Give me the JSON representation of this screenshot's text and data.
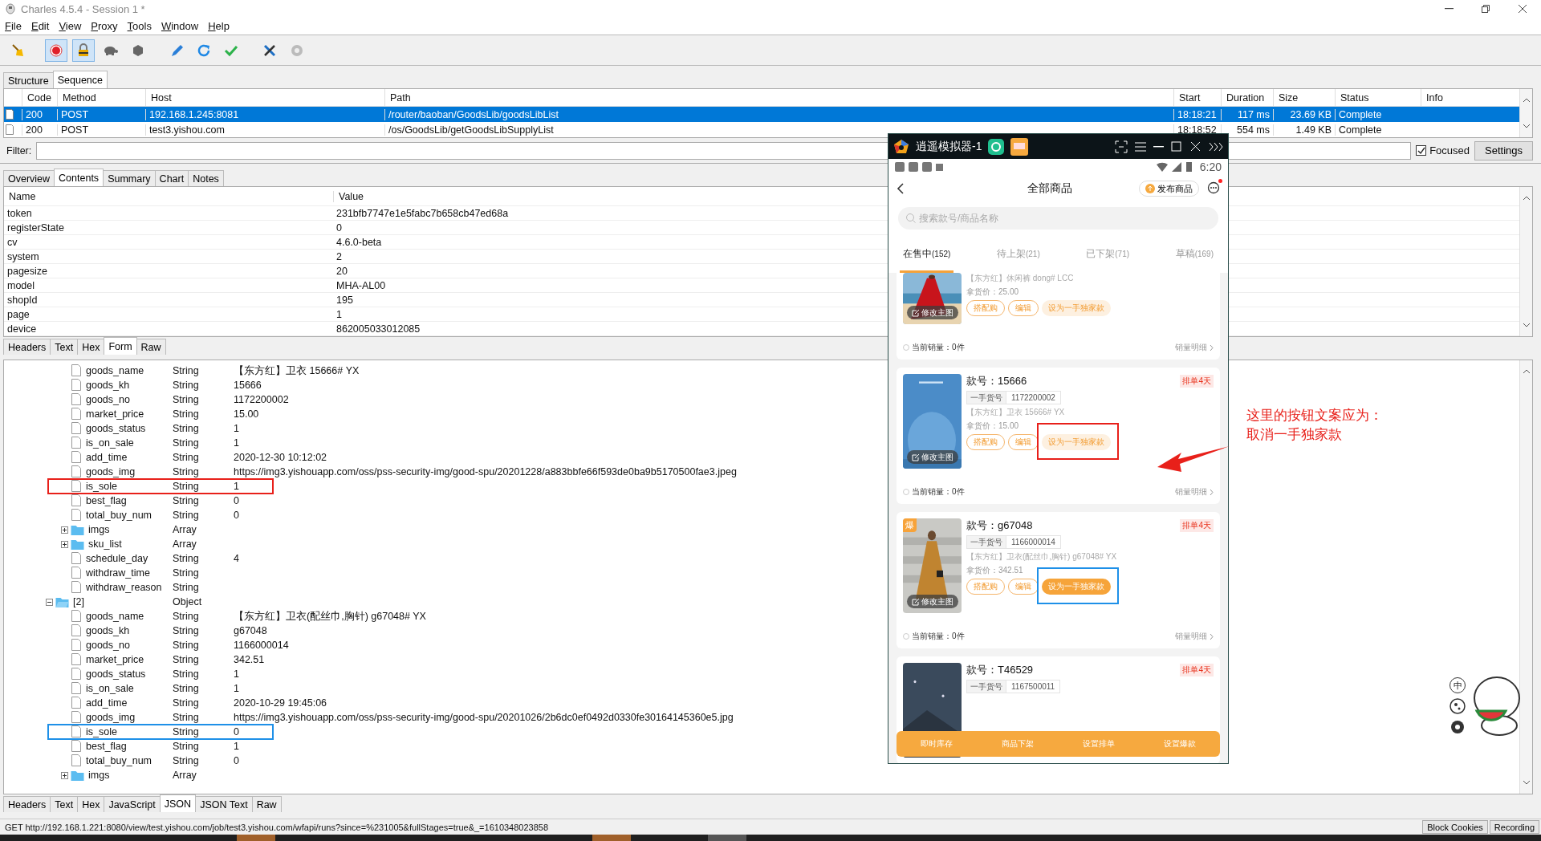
{
  "window": {
    "title": "Charles 4.5.4 - Session 1 *"
  },
  "menu": [
    "File",
    "Edit",
    "View",
    "Proxy",
    "Tools",
    "Window",
    "Help"
  ],
  "toolbar": [
    {
      "kind": "broom",
      "pressed": false
    },
    {
      "kind": "record",
      "pressed": true
    },
    {
      "kind": "throttle",
      "pressed": true
    },
    {
      "kind": "turtle",
      "pressed": false
    },
    {
      "kind": "stop",
      "pressed": false
    },
    {
      "kind": "pen",
      "pressed": false
    },
    {
      "kind": "refresh",
      "pressed": false
    },
    {
      "kind": "check",
      "pressed": false
    },
    {
      "kind": "tools",
      "pressed": false
    },
    {
      "kind": "gear",
      "pressed": false
    }
  ],
  "view_tabs": [
    {
      "label": "Structure",
      "selected": false
    },
    {
      "label": "Sequence",
      "selected": true
    }
  ],
  "requests": {
    "columns": [
      "Code",
      "Method",
      "Host",
      "Path",
      "Start",
      "Duration",
      "Size",
      "Status",
      "Info"
    ],
    "rows": [
      {
        "selected": true,
        "cells": [
          "200",
          "POST",
          "192.168.1.245:8081",
          "/router/baoban/GoodsLib/goodsLibList",
          "18:18:21",
          "117 ms",
          "23.69 KB",
          "Complete"
        ]
      },
      {
        "selected": false,
        "cells": [
          "200",
          "POST",
          "test3.yishou.com",
          "/os/GoodsLib/getGoodsLibSupplyList",
          "18:18:52",
          "554 ms",
          "1.49 KB",
          "Complete"
        ]
      }
    ]
  },
  "filter": {
    "label": "Filter:",
    "focused": {
      "label": "Focused",
      "checked": true
    },
    "settings": "Settings"
  },
  "detail_tabs": [
    {
      "label": "Overview",
      "selected": false
    },
    {
      "label": "Contents",
      "selected": true
    },
    {
      "label": "Summary",
      "selected": false
    },
    {
      "label": "Chart",
      "selected": false
    },
    {
      "label": "Notes",
      "selected": false
    }
  ],
  "params": {
    "columns": [
      "Name",
      "Value"
    ],
    "rows": [
      [
        "token",
        "231bfb7747e1e5fabc7b658cb47ed68a"
      ],
      [
        "registerState",
        "0"
      ],
      [
        "cv",
        "4.6.0-beta"
      ],
      [
        "system",
        "2"
      ],
      [
        "pagesize",
        "20"
      ],
      [
        "model",
        "MHA-AL00"
      ],
      [
        "shopId",
        "195"
      ],
      [
        "page",
        "1"
      ],
      [
        "device",
        "862005033012085"
      ]
    ]
  },
  "body_tabs": [
    {
      "label": "Headers",
      "selected": false
    },
    {
      "label": "Text",
      "selected": false
    },
    {
      "label": "Hex",
      "selected": false
    },
    {
      "label": "Form",
      "selected": true
    },
    {
      "label": "Raw",
      "selected": false
    }
  ],
  "tree": {
    "continued_children": [
      {
        "kind": "string",
        "name": "goods_name",
        "type": "String",
        "value": "【东方红】卫衣  15666#  YX"
      },
      {
        "kind": "string",
        "name": "goods_kh",
        "type": "String",
        "value": "15666"
      },
      {
        "kind": "string",
        "name": "goods_no",
        "type": "String",
        "value": "1172200002"
      },
      {
        "kind": "string",
        "name": "market_price",
        "type": "String",
        "value": "15.00"
      },
      {
        "kind": "string",
        "name": "goods_status",
        "type": "String",
        "value": "1"
      },
      {
        "kind": "string",
        "name": "is_on_sale",
        "type": "String",
        "value": "1"
      },
      {
        "kind": "string",
        "name": "add_time",
        "type": "String",
        "value": "2020-12-30 10:12:02"
      },
      {
        "kind": "string",
        "name": "goods_img",
        "type": "String",
        "value": "https://img3.yishouapp.com/oss/pss-security-img/good-spu/20201228/a883bbfe66f593de0ba9b5170500fae3.jpeg"
      },
      {
        "kind": "string",
        "name": "is_sole",
        "type": "String",
        "value": "1",
        "annotation": {
          "color": "#e8201a"
        }
      },
      {
        "kind": "string",
        "name": "best_flag",
        "type": "String",
        "value": "0"
      },
      {
        "kind": "string",
        "name": "total_buy_num",
        "type": "String",
        "value": "0"
      },
      {
        "kind": "array",
        "name": "imgs",
        "type": "Array",
        "expanded": false
      },
      {
        "kind": "array",
        "name": "sku_list",
        "type": "Array",
        "expanded": false
      },
      {
        "kind": "string",
        "name": "schedule_day",
        "type": "String",
        "value": "4"
      },
      {
        "kind": "string",
        "name": "withdraw_time",
        "type": "String"
      },
      {
        "kind": "string",
        "name": "withdraw_reason",
        "type": "String"
      }
    ],
    "nodes": [
      {
        "kind": "object",
        "name": "[2]",
        "type": "Object",
        "expanded": true,
        "children": [
          {
            "kind": "string",
            "name": "goods_name",
            "type": "String",
            "value": "【东方红】卫衣(配丝巾,胸针)  g67048#  YX"
          },
          {
            "kind": "string",
            "name": "goods_kh",
            "type": "String",
            "value": "g67048"
          },
          {
            "kind": "string",
            "name": "goods_no",
            "type": "String",
            "value": "1166000014"
          },
          {
            "kind": "string",
            "name": "market_price",
            "type": "String",
            "value": "342.51"
          },
          {
            "kind": "string",
            "name": "goods_status",
            "type": "String",
            "value": "1"
          },
          {
            "kind": "string",
            "name": "is_on_sale",
            "type": "String",
            "value": "1"
          },
          {
            "kind": "string",
            "name": "add_time",
            "type": "String",
            "value": "2020-10-29 19:45:06"
          },
          {
            "kind": "string",
            "name": "goods_img",
            "type": "String",
            "value": "https://img3.yishouapp.com/oss/pss-security-img/good-spu/20201026/2b6dc0ef0492d0330fe30164145360e5.jpg"
          },
          {
            "kind": "string",
            "name": "is_sole",
            "type": "String",
            "value": "0",
            "annotation": {
              "color": "#1e90e8"
            }
          },
          {
            "kind": "string",
            "name": "best_flag",
            "type": "String",
            "value": "1"
          },
          {
            "kind": "string",
            "name": "total_buy_num",
            "type": "String",
            "value": "0"
          },
          {
            "kind": "array",
            "name": "imgs",
            "type": "Array",
            "expanded": false
          }
        ]
      }
    ]
  },
  "response_tabs": [
    {
      "label": "Headers",
      "selected": false
    },
    {
      "label": "Text",
      "selected": false
    },
    {
      "label": "Hex",
      "selected": false
    },
    {
      "label": "JavaScript",
      "selected": false
    },
    {
      "label": "JSON",
      "selected": true
    },
    {
      "label": "JSON Text",
      "selected": false
    },
    {
      "label": "Raw",
      "selected": false
    }
  ],
  "status_bar": {
    "text": "GET http://192.168.1.221:8080/view/test.yishou.com/job/test3.yishou.com/wfapi/runs?since=%231005&fullStages=true&_=1610348023858",
    "buttons": [
      "Block Cookies",
      "Recording"
    ]
  },
  "emulator": {
    "title": "逍遥模拟器-1",
    "time": "6:20",
    "page_title": "全部商品",
    "publish": "发布商品",
    "search_placeholder": "搜索款号/商品名称",
    "tabs": [
      {
        "label": "在售中",
        "count": "(152)",
        "selected": true
      },
      {
        "label": "待上架",
        "count": "(21)",
        "selected": false
      },
      {
        "label": "已下架",
        "count": "(71)",
        "selected": false
      },
      {
        "label": "草稿",
        "count": "(169)",
        "selected": false
      }
    ],
    "products": [
      {
        "name": "【东方红】休闲裤 dong# LCC",
        "price": "拿货价：25.00",
        "edit_image": "修改主图",
        "buttons": [
          "搭配购",
          "编辑"
        ],
        "exclusive": {
          "label": "设为一手独家款",
          "active": false
        },
        "sales": "当前销量：0件",
        "details": "销量明细"
      },
      {
        "code": "款号：15666",
        "badge": "排单4天",
        "sku_label": "一手货号",
        "sku": "1172200002",
        "name": "【东方红】卫衣 15666# YX",
        "price": "拿货价：15.00",
        "edit_image": "修改主图",
        "buttons": [
          "搭配购",
          "编辑"
        ],
        "exclusive": {
          "label": "设为一手独家款",
          "active": false,
          "annotation": {
            "color": "#e8201a"
          }
        },
        "sales": "当前销量：0件",
        "details": "销量明细"
      },
      {
        "hot": "爆",
        "code": "款号：g67048",
        "badge": "排单4天",
        "sku_label": "一手货号",
        "sku": "1166000014",
        "name": "【东方红】卫衣(配丝巾,胸针) g67048# YX",
        "price": "拿货价：342.51",
        "edit_image": "修改主图",
        "buttons": [
          "搭配购",
          "编辑"
        ],
        "exclusive": {
          "label": "设为一手独家款",
          "active": true,
          "annotation": {
            "color": "#1e90e8"
          }
        },
        "sales": "当前销量：0件",
        "details": "销量明细"
      },
      {
        "code": "款号：T46529",
        "badge": "排单4天",
        "sku_label": "一手货号",
        "sku": "1167500011"
      }
    ],
    "bottom_actions": [
      "即时库存",
      "商品下架",
      "设置排单",
      "设置爆款"
    ]
  },
  "note": {
    "lines": [
      "这里的按钮文案应为：",
      "取消一手独家款"
    ]
  },
  "desktop_widget": {
    "ime": "中"
  }
}
